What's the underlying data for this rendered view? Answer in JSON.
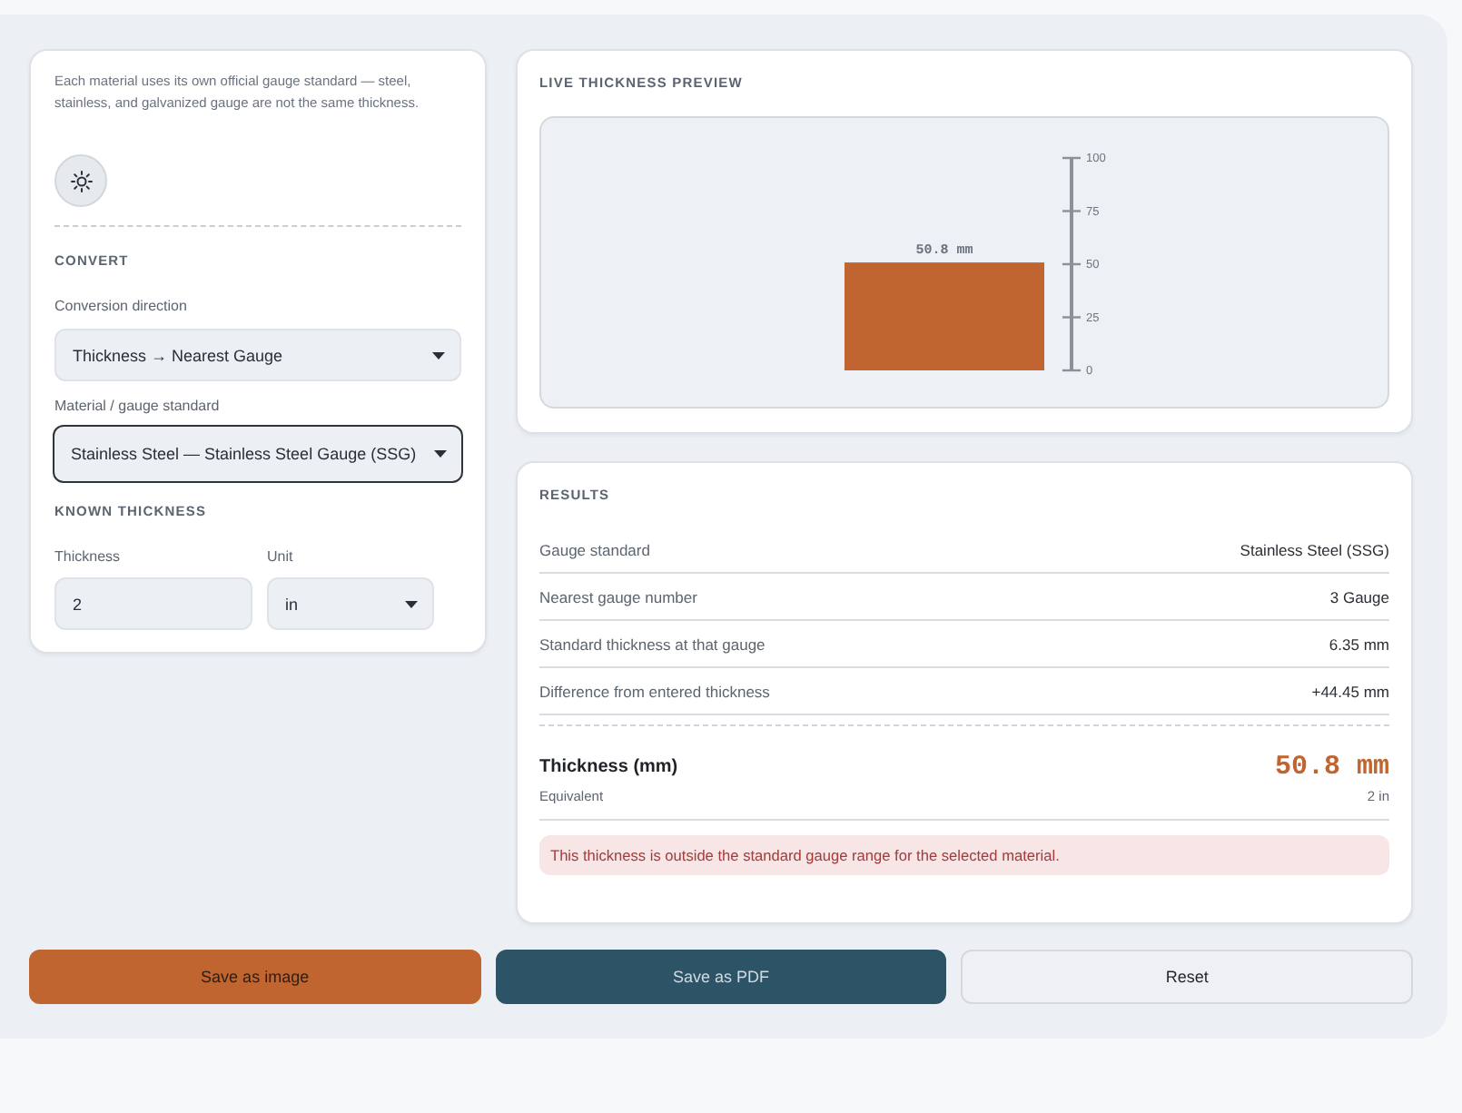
{
  "intro": {
    "description": "Each material uses its own official gauge standard — steel, stainless, and galvanized gauge are not the same thickness."
  },
  "convert": {
    "heading": "CONVERT",
    "fields": [
      {
        "kind": "select",
        "label": "Conversion direction",
        "value": "Thickness → Nearest Gauge",
        "focused": false
      },
      {
        "kind": "select",
        "label": "Material / gauge standard",
        "value": "Stainless Steel — Stainless Steel Gauge (SSG)",
        "focused": true
      }
    ]
  },
  "known_thickness": {
    "heading": "KNOWN THICKNESS",
    "fields": [
      {
        "kind": "input",
        "label": "Thickness",
        "value": "2",
        "focused": false
      },
      {
        "kind": "select",
        "label": "Unit",
        "value": "in",
        "focused": false
      }
    ]
  },
  "preview": {
    "heading": "LIVE THICKNESS PREVIEW",
    "scale_labels": [
      "100",
      "75",
      "50",
      "25",
      "0"
    ],
    "bar_label": "50.8 mm",
    "level": 0.508
  },
  "results": {
    "heading": "RESULTS",
    "rows": [
      {
        "label": "Gauge standard",
        "value": "Stainless Steel (SSG)"
      },
      {
        "label": "Nearest gauge number",
        "value": "3 Gauge"
      },
      {
        "label": "Standard thickness at that gauge",
        "value": "6.35 mm"
      },
      {
        "label": "Difference from entered thickness",
        "value": "+44.45 mm"
      }
    ],
    "primary": {
      "label": "Thickness (mm)",
      "value": "50.8 mm"
    },
    "equivalent": {
      "label": "Equivalent",
      "value": "2 in"
    },
    "alert": {
      "text": "This thickness is outside the standard gauge range for the selected material."
    }
  },
  "actions": [
    {
      "kind": "primary",
      "label": "Save as image"
    },
    {
      "kind": "secondary",
      "label": "Save as PDF"
    },
    {
      "kind": "plain",
      "label": "Reset"
    }
  ]
}
